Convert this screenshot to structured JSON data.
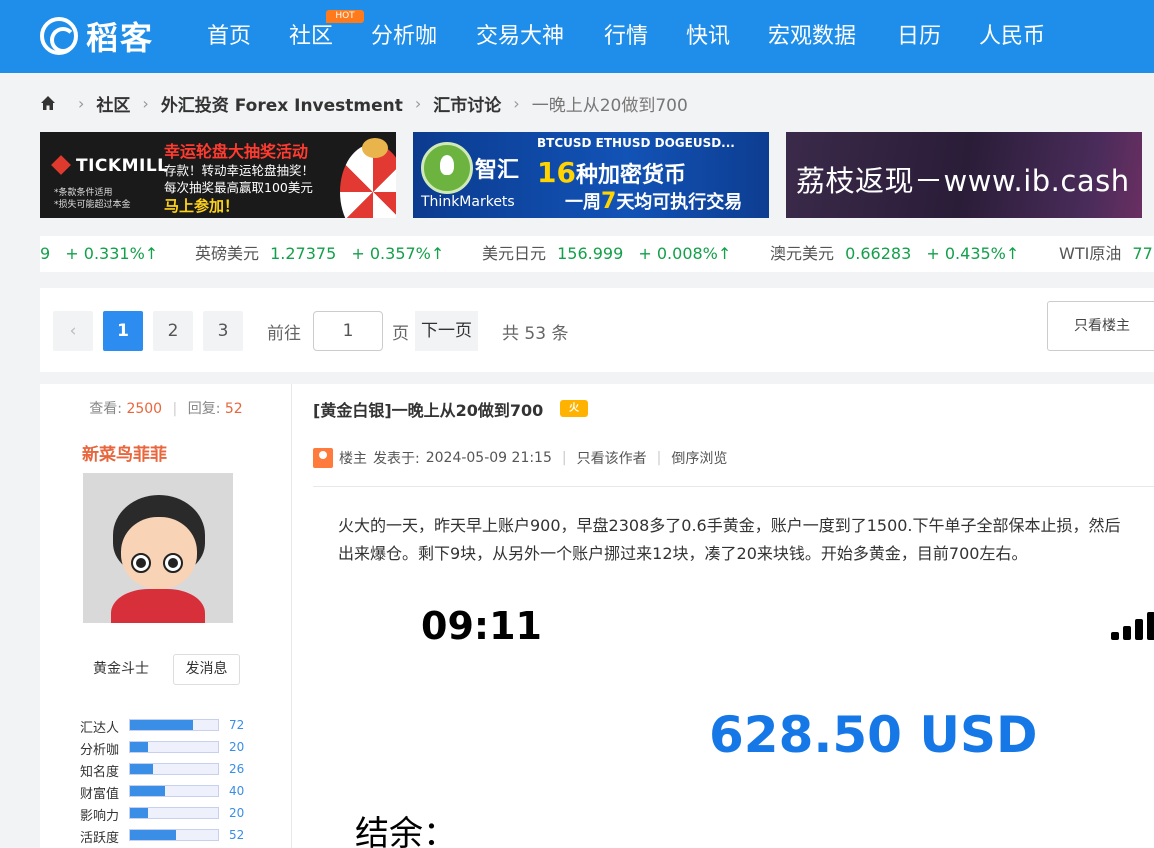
{
  "header": {
    "logo_text": "稻客",
    "nav": [
      "首页",
      "社区",
      "分析咖",
      "交易大神",
      "行情",
      "快讯",
      "宏观数据",
      "日历",
      "人民币"
    ],
    "hot_badge": "HOT",
    "colors": {
      "bar": "#1e8eea",
      "hot": "#ff7a1a"
    }
  },
  "breadcrumb": {
    "items": [
      "社区",
      "外汇投资 Forex Investment",
      "汇市讨论"
    ],
    "current": "一晚上从20做到700"
  },
  "banners": {
    "tickmill": {
      "brand": "TICKMILL",
      "title": "幸运轮盘大抽奖活动",
      "line1": "存款！转动幸运轮盘抽奖！",
      "line2": "每次抽奖最高赢取100美元",
      "cta": "马上参加！",
      "note1": "*条款条件适用",
      "note2": "*损失可能超过本金"
    },
    "thinkmarkets": {
      "brand": "智汇",
      "sub": "ThinkMarkets",
      "top": "BTCUSD ETHUSD DOGEUSD...",
      "mid_num": "16",
      "mid_text": "种加密货币",
      "bot_pre": "一周",
      "bot_num": "7",
      "bot_text": "天均可执行交易"
    },
    "ibcash": {
      "text": "荔枝返现－www.ib.cash"
    }
  },
  "ticker": [
    {
      "name": "",
      "value": "9",
      "change": "+ 0.331%↑"
    },
    {
      "name": "英磅美元",
      "value": "1.27375",
      "change": "+ 0.357%↑"
    },
    {
      "name": "美元日元",
      "value": "156.999",
      "change": "+ 0.008%↑"
    },
    {
      "name": "澳元美元",
      "value": "0.66283",
      "change": "+ 0.435%↑"
    },
    {
      "name": "WTI原油",
      "value": "77",
      "change": ""
    }
  ],
  "pagination": {
    "prev": "‹",
    "pages": [
      "1",
      "2",
      "3"
    ],
    "active_page": "1",
    "goto_label": "前往",
    "goto_value": "1",
    "page_unit": "页",
    "next": "下一页",
    "total": "共 53 条",
    "only_owner": "只看楼主"
  },
  "author": {
    "views_label": "查看:",
    "views": "2500",
    "replies_label": "回复:",
    "replies": "52",
    "name": "新菜鸟菲菲",
    "rank": "黄金斗士",
    "message_btn": "发消息",
    "stats": [
      {
        "label": "汇达人",
        "value": 72
      },
      {
        "label": "分析咖",
        "value": 20
      },
      {
        "label": "知名度",
        "value": 26
      },
      {
        "label": "财富值",
        "value": 40
      },
      {
        "label": "影响力",
        "value": 20
      },
      {
        "label": "活跃度",
        "value": 52
      }
    ]
  },
  "post": {
    "title": "[黄金白银]一晚上从20做到700",
    "fire_badge": "火",
    "owner_label": "楼主",
    "posted_label": "发表于:",
    "posted_at": "2024-05-09 21:15",
    "view_author": "只看该作者",
    "reverse": "倒序浏览",
    "body_line1": "火大的一天，昨天早上账户900，早盘2308多了0.6手黄金，账户一度到了1500.下午单子全部保本止损，然后",
    "body_line2": "出来爆仓。剩下9块，从另外一个账户挪过来12块，凑了20来块钱。开始多黄金，目前700左右。",
    "image": {
      "time": "09:11",
      "amount": "628.50 USD",
      "balance_label": "结余："
    }
  }
}
